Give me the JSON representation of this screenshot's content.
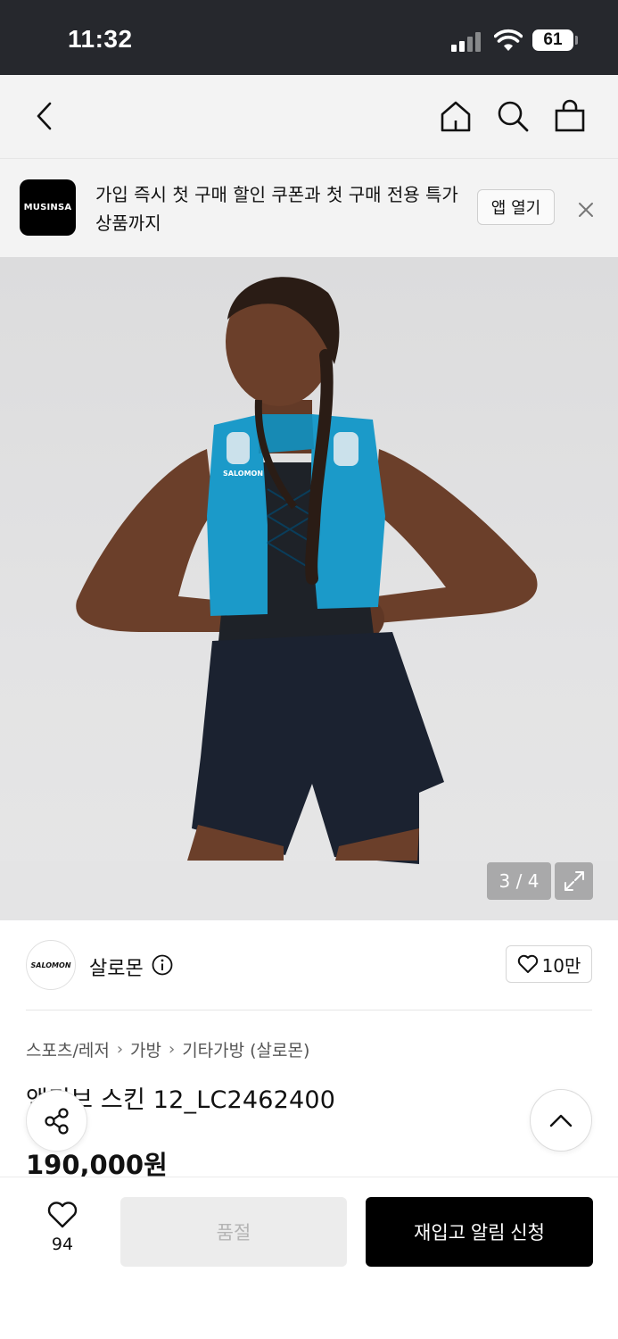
{
  "status_bar": {
    "time": "11:32",
    "battery": "61"
  },
  "nav": {
    "back_icon": "chevron-left-icon",
    "home_icon": "home-icon",
    "search_icon": "search-icon",
    "cart_icon": "shopping-bag-icon"
  },
  "promo": {
    "logo_text": "MUSINSA",
    "message": "가입 즉시 첫 구매 할인 쿠폰과 첫 구매 전용 특가 상품까지",
    "open_app_label": "앱 열기",
    "close_icon": "close-icon"
  },
  "gallery": {
    "counter": "3 / 4",
    "expand_icon": "expand-icon",
    "vest_brand_text": "SALOMON"
  },
  "brand": {
    "logo_text": "SALOMON",
    "name": "살로몬",
    "info_icon": "info-icon",
    "like_count": "10만"
  },
  "breadcrumb": [
    "스포츠/레저",
    "가방",
    "기타가방 (살로몬)"
  ],
  "product": {
    "title": "액티브 스킨 12_LC2462400",
    "price": "190,000원"
  },
  "floating": {
    "share_icon": "share-icon",
    "top_icon": "chevron-up-icon"
  },
  "bottom_bar": {
    "like_count": "94",
    "soldout_label": "품절",
    "restock_label": "재입고 알림 신청"
  },
  "colors": {
    "status_bar": "#26282d",
    "header_bg": "#f3f3f3",
    "vest": "#1b9ac9",
    "primary_button": "#000000",
    "disabled_button": "#ececec"
  }
}
